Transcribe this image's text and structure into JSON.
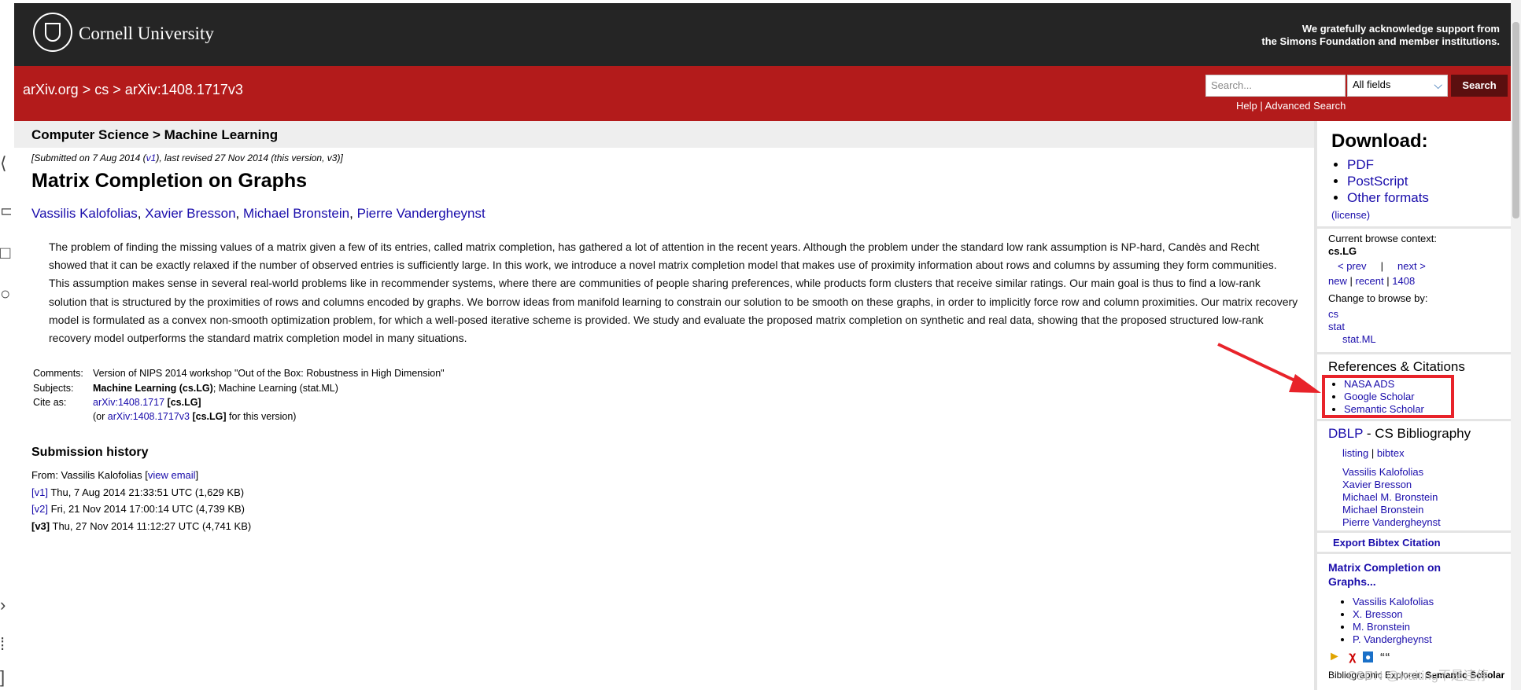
{
  "header": {
    "logo_text": "Cornell University",
    "support_line1": "We gratefully acknowledge support from",
    "support_line2": "the Simons Foundation and member institutions."
  },
  "nav": {
    "crumb_home": "arXiv.org",
    "crumb_sep": ">",
    "crumb_cs": "cs",
    "crumb_id": "arXiv:1408.1717v3",
    "search_placeholder": "Search...",
    "field_select": "All fields",
    "search_button": "Search",
    "help": "Help",
    "help_sep": "|",
    "advanced": "Advanced Search"
  },
  "subject_header": "Computer Science > Machine Learning",
  "paper": {
    "submitted_pre": "[Submitted on 7 Aug 2014 (",
    "submitted_v1": "v1",
    "submitted_post": "), last revised 27 Nov 2014 (this version, v3)]",
    "title": "Matrix Completion on Graphs",
    "authors": [
      "Vassilis Kalofolias",
      "Xavier Bresson",
      "Michael Bronstein",
      "Pierre Vandergheynst"
    ],
    "abstract": "The problem of finding the missing values of a matrix given a few of its entries, called matrix completion, has gathered a lot of attention in the recent years. Although the problem under the standard low rank assumption is NP-hard, Candès and Recht showed that it can be exactly relaxed if the number of observed entries is sufficiently large. In this work, we introduce a novel matrix completion model that makes use of proximity information about rows and columns by assuming they form communities. This assumption makes sense in several real-world problems like in recommender systems, where there are communities of people sharing preferences, while products form clusters that receive similar ratings. Our main goal is thus to find a low-rank solution that is structured by the proximities of rows and columns encoded by graphs. We borrow ideas from manifold learning to constrain our solution to be smooth on these graphs, in order to implicitly force row and column proximities. Our matrix recovery model is formulated as a convex non-smooth optimization problem, for which a well-posed iterative scheme is provided. We study and evaluate the proposed matrix completion on synthetic and real data, showing that the proposed structured low-rank recovery model outperforms the standard matrix completion model in many situations.",
    "comments_label": "Comments:",
    "comments": "Version of NIPS 2014 workshop \"Out of the Box: Robustness in High Dimension\"",
    "subjects_label": "Subjects:",
    "subjects_primary": "Machine Learning (cs.LG)",
    "subjects_rest": "; Machine Learning (stat.ML)",
    "cite_label": "Cite as:",
    "cite_link": "arXiv:1408.1717",
    "cite_tag": "[cs.LG]",
    "cite2_pre": "(or ",
    "cite2_link": "arXiv:1408.1717v3",
    "cite2_tag": "[cs.LG]",
    "cite2_post": " for this version)"
  },
  "history": {
    "heading": "Submission history",
    "from_pre": "From: Vassilis Kalofolias [",
    "from_link": "view email",
    "from_post": "]",
    "versions": [
      {
        "tag": "[v1]",
        "text": "Thu, 7 Aug 2014 21:33:51 UTC (1,629 KB)"
      },
      {
        "tag": "[v2]",
        "text": "Fri, 21 Nov 2014 17:00:14 UTC (4,739 KB)"
      },
      {
        "tag": "[v3]",
        "text": "Thu, 27 Nov 2014 11:12:27 UTC (4,741 KB)"
      }
    ]
  },
  "sidebar": {
    "download_heading": "Download:",
    "downloads": [
      "PDF",
      "PostScript",
      "Other formats"
    ],
    "license": "(license)",
    "browse_context_label": "Current browse context:",
    "browse_context": "cs.LG",
    "prev": "< prev",
    "browse_sep": "|",
    "next": "next >",
    "new": "new",
    "recent": "recent",
    "month": "1408",
    "change_browse": "Change to browse by:",
    "browse_cs": "cs",
    "browse_stat": "stat",
    "browse_statml": "stat.ML",
    "refs_heading": "References & Citations",
    "refs": [
      "NASA ADS",
      "Google Scholar",
      "Semantic Scholar"
    ],
    "dblp": "DBLP",
    "dblp_rest": " - CS Bibliography",
    "listing": "listing",
    "bibtex": "bibtex",
    "dblp_authors": [
      "Vassilis Kalofolias",
      "Xavier Bresson",
      "Michael M. Bronstein",
      "Michael Bronstein",
      "Pierre Vandergheynst"
    ],
    "export_bibtex": "Export Bibtex Citation",
    "related_title": "Matrix Completion on Graphs...",
    "related_authors": [
      "Vassilis Kalofolias",
      "X. Bresson",
      "M. Bronstein",
      "P. Vandergheynst"
    ],
    "bib_explorer": "Bibliographic Explorer:",
    "bib_explorer_bold": "Semantic Scholar"
  },
  "annotation": {
    "watermark": "CSDN @waiting不是违停",
    "highlight_color": "#e8232a"
  }
}
